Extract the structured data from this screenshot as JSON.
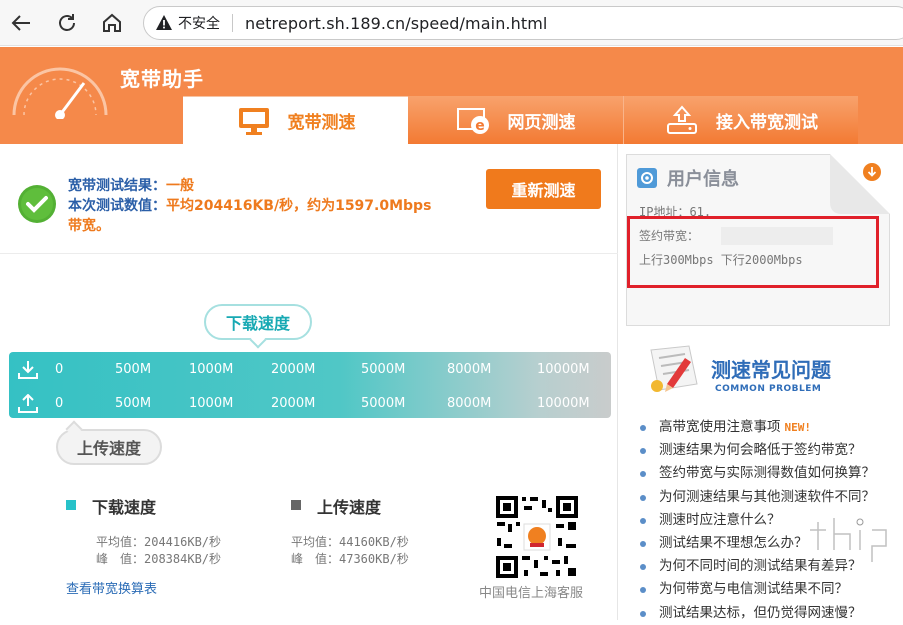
{
  "browser": {
    "insecure_label": "不安全",
    "url": "netreport.sh.189.cn/speed/main.html"
  },
  "header": {
    "brand": "宽带助手",
    "tabs": [
      {
        "label": "宽带测速",
        "icon": "monitor-icon",
        "active": true
      },
      {
        "label": "网页测速",
        "icon": "ie-browser-icon",
        "active": false
      },
      {
        "label": "接入带宽测试",
        "icon": "modem-icon",
        "active": false
      }
    ]
  },
  "result": {
    "label1": "宽带测试结果：",
    "value1": "一般",
    "label2": "本次测试数值：",
    "value2": "平均204416KB/秒，约为1597.0Mbps",
    "value2_cont": "带宽。",
    "retest_label": "重新测速"
  },
  "speed_bar": {
    "download_bubble": "下载速度",
    "upload_bubble": "上传速度",
    "download_ticks": [
      "0",
      "500M",
      "1000M",
      "2000M",
      "5000M",
      "8000M",
      "10000M"
    ],
    "upload_ticks": [
      "0",
      "500M",
      "1000M",
      "2000M",
      "5000M",
      "8000M",
      "10000M"
    ]
  },
  "stats": {
    "download": {
      "title": "下载速度",
      "avg": "平均值：204416KB/秒",
      "peak": "峰　值：208384KB/秒",
      "color": "#27c2c9"
    },
    "upload": {
      "title": "上传速度",
      "avg": "平均值：44160KB/秒",
      "peak": "峰　值：47360KB/秒",
      "color": "#666666"
    },
    "calc_link": "查看带宽换算表",
    "qr_caption": "中国电信上海客服"
  },
  "user_info": {
    "title": "用户信息",
    "ip": "IP地址：61.",
    "contract_label": "签约带宽：",
    "rates": "上行300Mbps 下行2000Mbps"
  },
  "faq": {
    "title": "测速常见问题",
    "subtitle": "COMMON PROBLEM",
    "new_badge": "NEW!",
    "items": [
      "高带宽使用注意事项",
      "测速结果为何会略低于签约带宽？",
      "签约带宽与实际测得数值如何换算？",
      "为何测速结果与其他测速软件不同？",
      "测速时应注意什么？",
      "测试结果不理想怎么办？",
      "为何不同时间的测试结果有差异？",
      "为何带宽与电信测试结果不同？",
      "测试结果达标，但仍觉得网速慢？"
    ]
  },
  "colors": {
    "brand_orange": "#f5894a",
    "accent_teal": "#35c1c4",
    "link_blue": "#2b6cb6",
    "highlight_red": "#e0202a"
  }
}
